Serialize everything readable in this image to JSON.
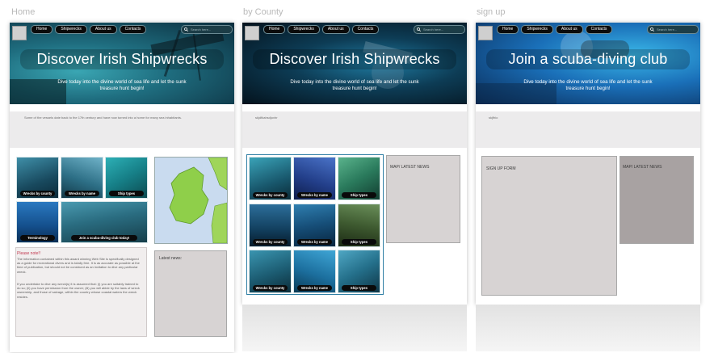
{
  "pages": [
    {
      "label": "Home",
      "hero_title": "Discover Irish Shipwrecks",
      "hero_subtitle": "Dive today into the divine world of sea life and let the sunk treasure hunt begin!",
      "intro": "Some of the vessels date back to the 17th century and have now turned into a home for many sea inhabitants.",
      "tiles": [
        "Wrecks by county",
        "Wrecks by name",
        "Ship types",
        "Terminology",
        "Join a scuba-diving club today!"
      ],
      "news_label": "Latest news:",
      "notice_title": "Please note!!",
      "notice_p1": "The information contained within this award winning Web Site is specifically designed as a guide for recreational divers and is totally free. It is as accurate as possible at the time of publication, but should not be construed as an invitation to dive any particular wreck.",
      "notice_p2": "If you undertake to dive any wreck(s) it is assumed that: (i) you are suitably trained to do so; (ii) you have permission from the owner; (iii) you will abide by the laws of wreck ownership, and those of salvage, within the country whose coastal waters the wreck resides."
    },
    {
      "label": "by County",
      "hero_title": "Discover Irish Shipwrecks",
      "hero_subtitle": "Dive today into the divine world of sea life and let the sunk treasure hunt begin!",
      "intro": "skjdfkahsdjovhr",
      "tiles": [
        "Wrecks by county",
        "Wrecks by name",
        "Ship types",
        "Wrecks by county",
        "Wrecks by name",
        "Ship types",
        "Wrecks by county",
        "Wrecks by name",
        "Ship types"
      ],
      "side_label": "MAP/ LATEST NEWS"
    },
    {
      "label": "sign up",
      "hero_title": "Join a scuba-diving club",
      "hero_subtitle": "Dive today into the divine world of sea life and let the sunk treasure hunt begin!",
      "intro": "skjfhio",
      "form_label": "SIGN UP FORM",
      "side_label": "MAP/ LATEST NEWS"
    }
  ],
  "nav": [
    "Home",
    "Shipwrecks",
    "About us",
    "Contacts"
  ],
  "search_placeholder": "Search here...",
  "colors": {
    "box_gray": "#d7d3d3",
    "box_dark": "#a8a2a2",
    "intro_bg": "#ecebec",
    "accent": "#2f7fa4"
  }
}
